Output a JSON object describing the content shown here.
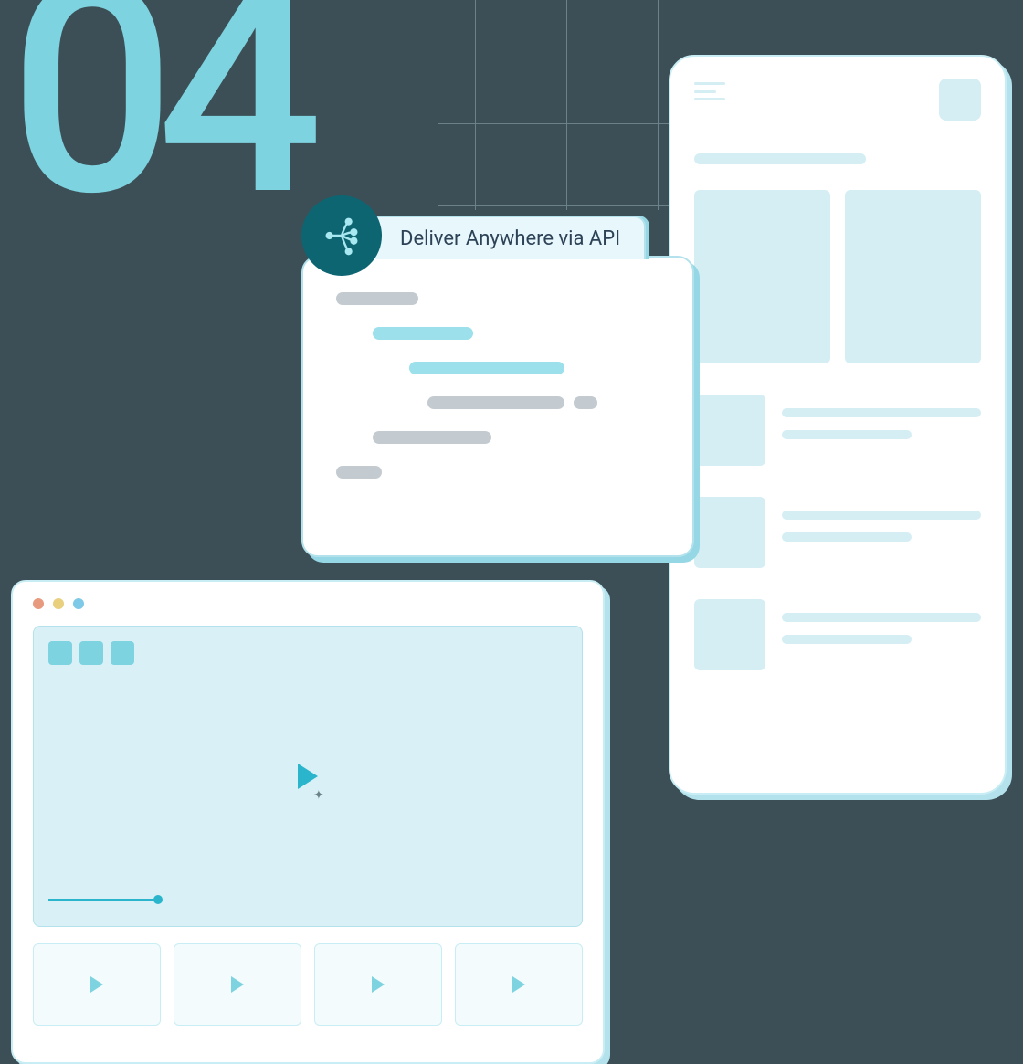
{
  "step_number": "04",
  "api_card": {
    "title": "Deliver Anywhere via API",
    "icon": "api-network-icon"
  },
  "browser": {
    "window_controls": [
      "close",
      "minimize",
      "maximize"
    ],
    "thumbnail_count": 4
  },
  "mobile": {
    "list_item_count": 3
  }
}
